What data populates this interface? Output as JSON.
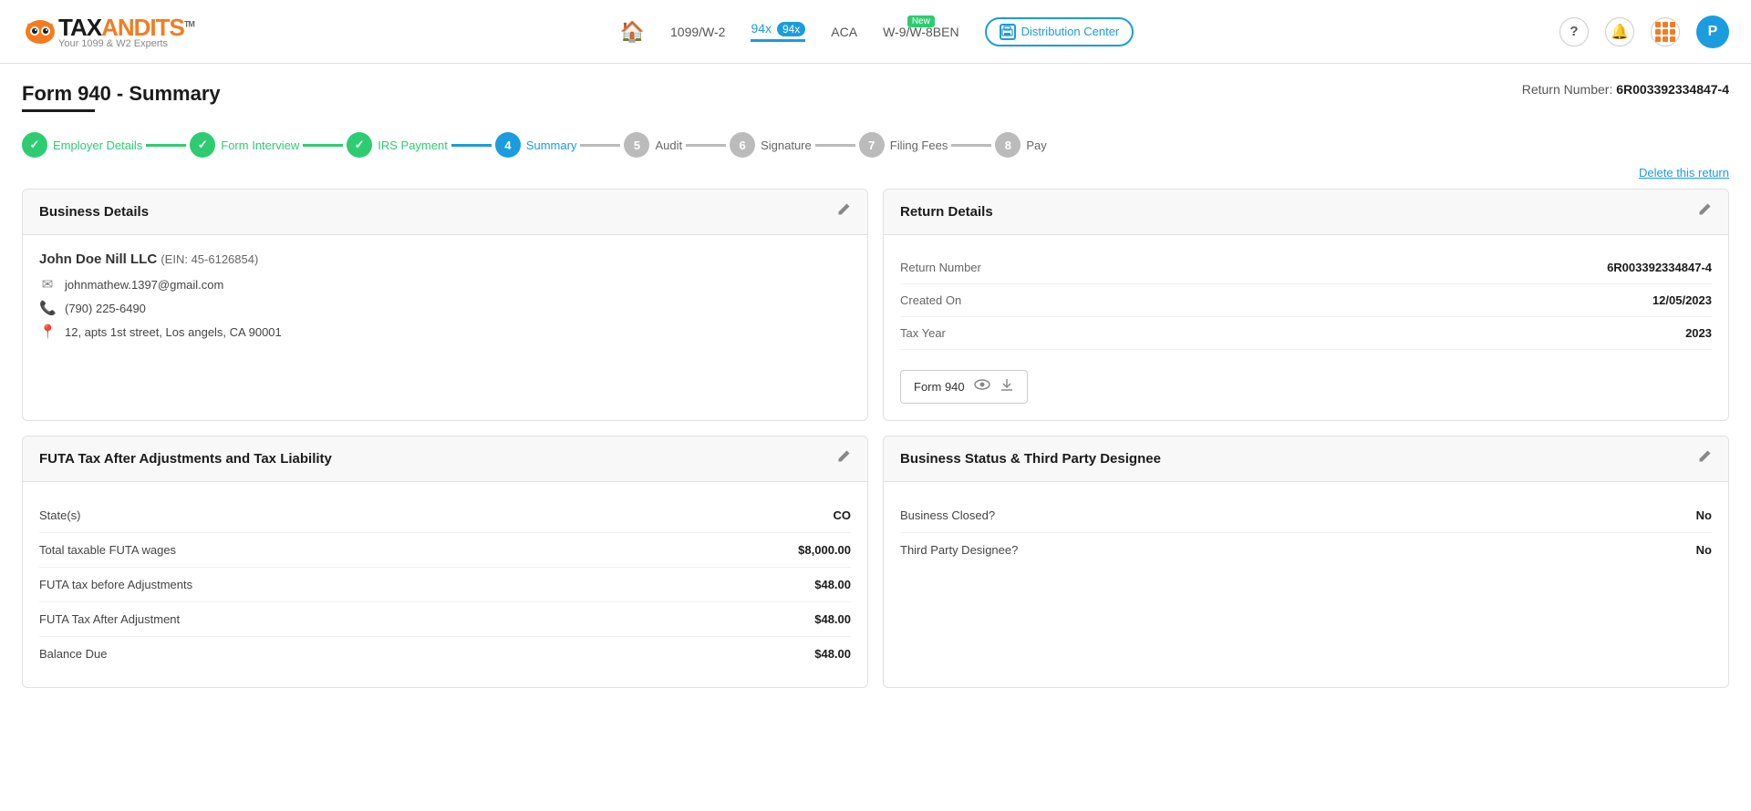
{
  "header": {
    "logo_tax": "TAX",
    "logo_bandits": "ANDITS",
    "logo_tm": "TM",
    "logo_sub": "Your 1099 & W2 Experts",
    "nav": {
      "home_icon": "🏠",
      "items": [
        {
          "label": "1099/W-2",
          "active": false
        },
        {
          "label": "94x",
          "active": true,
          "badge": ""
        },
        {
          "label": "ACA",
          "active": false
        },
        {
          "label": "W-9/W-8BEN",
          "active": false,
          "new_badge": "New"
        }
      ],
      "distribution_center": "Distribution Center",
      "help_icon": "?",
      "bell_icon": "🔔",
      "avatar": "P"
    }
  },
  "page": {
    "title": "Form 940 - Summary",
    "return_label": "Return Number:",
    "return_number": "6R003392334847-4"
  },
  "steps": [
    {
      "number": "✓",
      "label": "Employer Details",
      "state": "done"
    },
    {
      "number": "✓",
      "label": "Form Interview",
      "state": "done"
    },
    {
      "number": "✓",
      "label": "IRS Payment",
      "state": "done"
    },
    {
      "number": "4",
      "label": "Summary",
      "state": "active"
    },
    {
      "number": "5",
      "label": "Audit",
      "state": "inactive"
    },
    {
      "number": "6",
      "label": "Signature",
      "state": "inactive"
    },
    {
      "number": "7",
      "label": "Filing Fees",
      "state": "inactive"
    },
    {
      "number": "8",
      "label": "Pay",
      "state": "inactive"
    }
  ],
  "delete_link": "Delete this return",
  "business_details": {
    "title": "Business Details",
    "biz_name": "John Doe Nill LLC",
    "ein": "(EIN: 45-6126854)",
    "email": "johnmathew.1397@gmail.com",
    "phone": "(790) 225-6490",
    "address": "12, apts 1st street, Los angels, CA 90001"
  },
  "return_details": {
    "title": "Return Details",
    "rows": [
      {
        "label": "Return Number",
        "value": "6R003392334847-4"
      },
      {
        "label": "Created On",
        "value": "12/05/2023"
      },
      {
        "label": "Tax Year",
        "value": "2023"
      }
    ],
    "form_button": "Form 940"
  },
  "futa": {
    "title": "FUTA Tax After Adjustments and Tax Liability",
    "rows": [
      {
        "label": "State(s)",
        "value": "CO"
      },
      {
        "label": "Total taxable FUTA wages",
        "value": "$8,000.00"
      },
      {
        "label": "FUTA tax before Adjustments",
        "value": "$48.00"
      },
      {
        "label": "FUTA Tax After Adjustment",
        "value": "$48.00"
      },
      {
        "label": "Balance Due",
        "value": "$48.00"
      }
    ]
  },
  "business_status": {
    "title": "Business Status & Third Party Designee",
    "rows": [
      {
        "label": "Business Closed?",
        "value": "No"
      },
      {
        "label": "Third Party Designee?",
        "value": "No"
      }
    ]
  },
  "colors": {
    "green": "#2ecc71",
    "blue": "#1b9cde",
    "orange": "#f47c20",
    "inactive": "#bbb"
  }
}
